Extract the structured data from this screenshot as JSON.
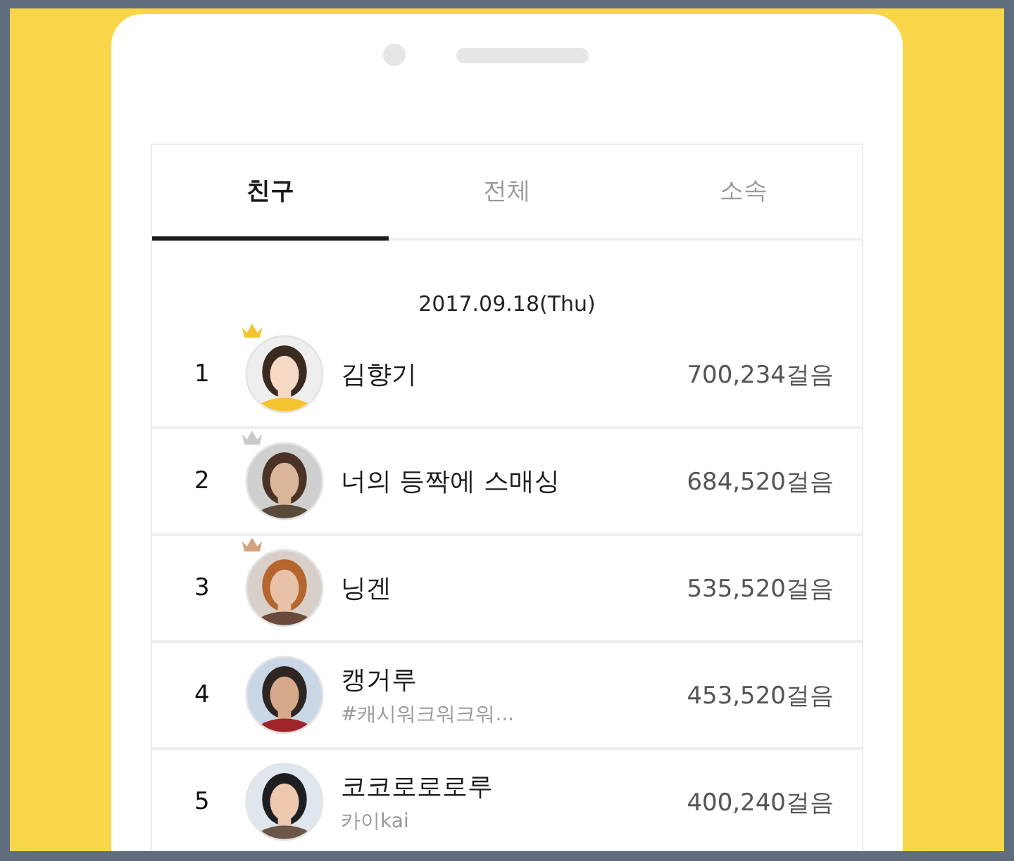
{
  "tabs": [
    {
      "label": "친구",
      "selected": true
    },
    {
      "label": "전체",
      "selected": false
    },
    {
      "label": "소속",
      "selected": false
    }
  ],
  "date": "2017.09.18(Thu)",
  "rows": [
    {
      "rank": "1",
      "name": "김향기",
      "steps": "700,234걸음",
      "color": "#f4c430"
    },
    {
      "rank": "2",
      "name": "너의 등짝에 스매싱",
      "steps": "684,520걸음",
      "color": "#c8c8c8"
    },
    {
      "rank": "3",
      "name": "닝겐",
      "steps": "535,520걸음",
      "color": "#d4a27a"
    },
    {
      "rank": "4",
      "name": "캥거루",
      "status": "#캐시워크워크워...",
      "steps": "453,520걸음"
    },
    {
      "rank": "5",
      "name": "코코로로로루",
      "status": "카이kai",
      "steps": "400,240걸음"
    }
  ]
}
